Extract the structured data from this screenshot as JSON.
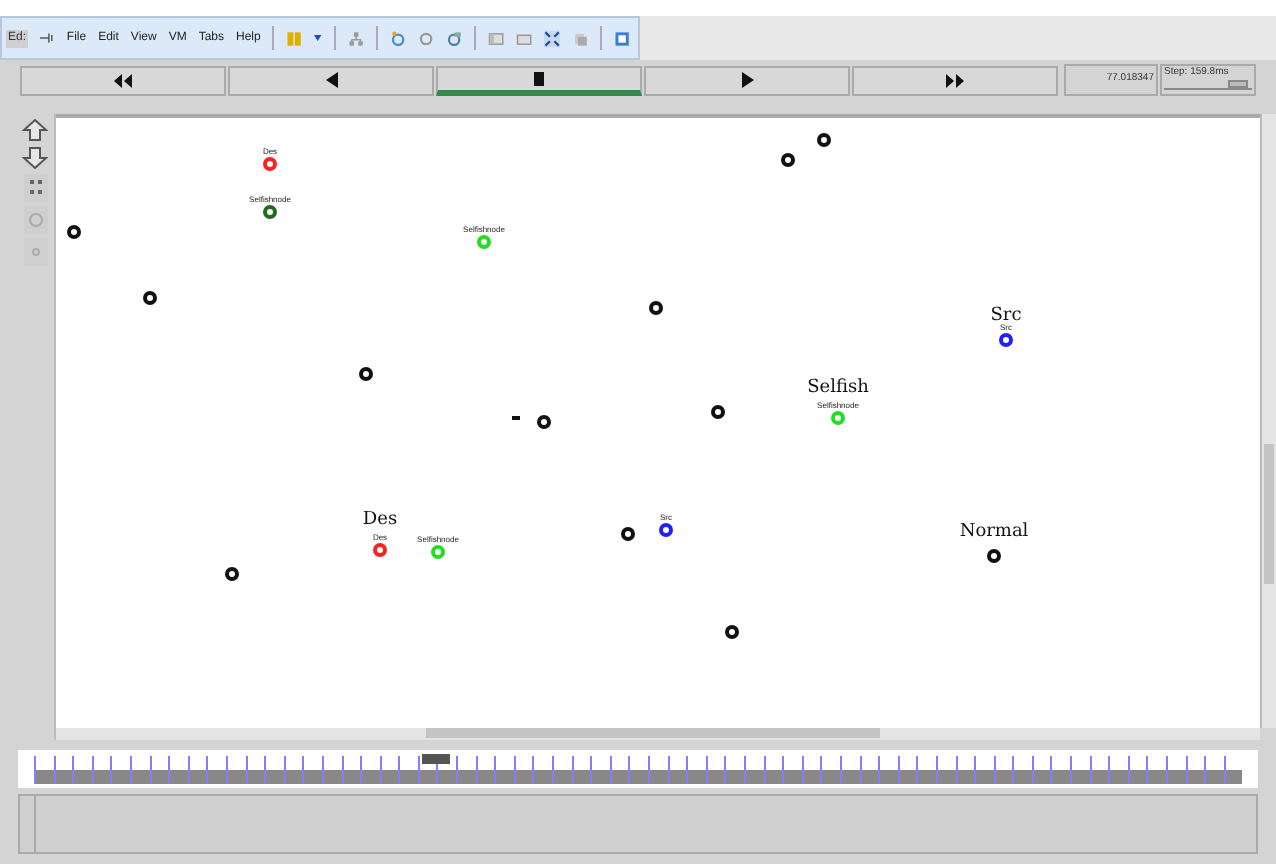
{
  "menu_bar": {
    "cut_label": "Ed:",
    "items": [
      "File",
      "Edit",
      "View",
      "VM",
      "Tabs",
      "Help"
    ]
  },
  "transport": [
    {
      "kind": "rewind",
      "selected": false
    },
    {
      "kind": "back",
      "selected": false
    },
    {
      "kind": "stop",
      "selected": true
    },
    {
      "kind": "play",
      "selected": false
    },
    {
      "kind": "forward",
      "selected": false
    }
  ],
  "time": "77.018347",
  "step": "Step: 159.8ms",
  "step_slider": {
    "level": 0.85
  },
  "nodes": [
    {
      "color": "#ff2020",
      "label": "Des"
    },
    {
      "color": "#1f6b1f",
      "label": "Selfishnode"
    },
    {
      "color": "#111111"
    },
    {
      "color": "#111111"
    },
    {
      "color": "#22dd22",
      "label": "Selfishnode"
    },
    {
      "color": "#111111"
    },
    {
      "color": "#111111"
    },
    {
      "color": "#111111"
    },
    {
      "color": "#2020ff",
      "label": "Src"
    },
    {
      "color": "#111111"
    },
    {
      "color": "#111111"
    },
    {
      "color": "#111111"
    },
    {
      "color": "#22dd22",
      "label": "Selfishnode"
    },
    {
      "color": "#ff2020",
      "label": "Des"
    },
    {
      "color": "#22dd22",
      "label": "Selfishnode"
    },
    {
      "color": "#111111"
    },
    {
      "color": "#2020ff",
      "label": "Src"
    },
    {
      "color": "#111111"
    },
    {
      "color": "#111111"
    },
    {
      "color": "#111111"
    }
  ],
  "annotations": [
    "Src",
    "Selfish",
    "Des",
    "Normal"
  ]
}
